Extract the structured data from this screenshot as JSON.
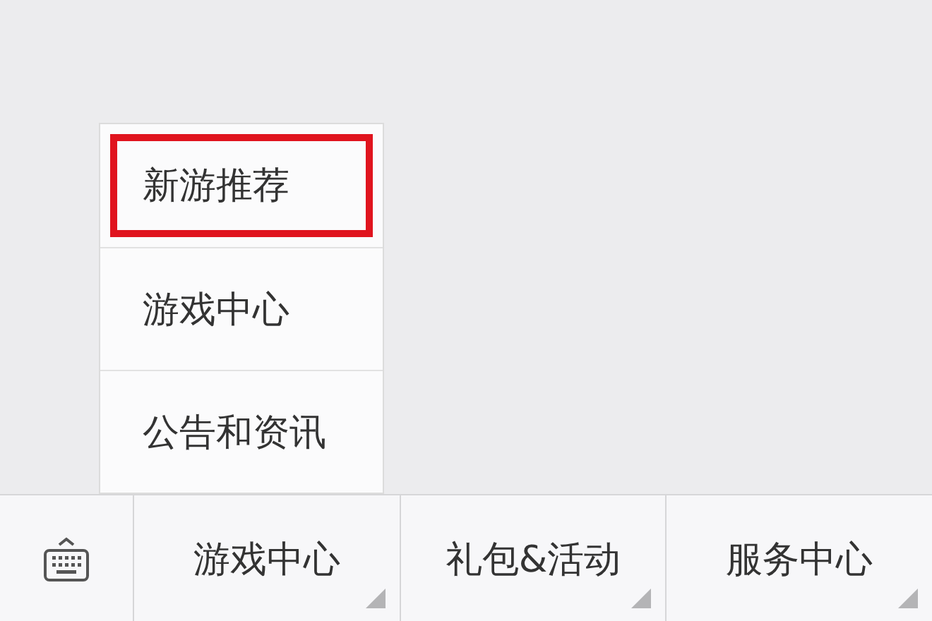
{
  "popup_menu": {
    "items": [
      {
        "label": "新游推荐",
        "highlighted": true
      },
      {
        "label": "游戏中心",
        "highlighted": false
      },
      {
        "label": "公告和资讯",
        "highlighted": false
      }
    ]
  },
  "bottom_menu": {
    "items": [
      {
        "label": "游戏中心"
      },
      {
        "label": "礼包&活动"
      },
      {
        "label": "服务中心"
      }
    ]
  }
}
